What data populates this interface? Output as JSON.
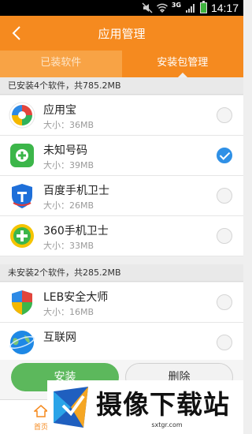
{
  "status_bar": {
    "time": "14:17",
    "network": "3G"
  },
  "header": {
    "title": "应用管理"
  },
  "tabs": [
    {
      "label": "已装软件",
      "active": false
    },
    {
      "label": "安装包管理",
      "active": true
    }
  ],
  "installed_section": {
    "heading": "已安装4个软件，共785.2MB",
    "items": [
      {
        "name": "应用宝",
        "size": "大小：36MB",
        "checked": false,
        "icon": "yingyongbao-icon"
      },
      {
        "name": "未知号码",
        "size": "大小：39MB",
        "checked": true,
        "icon": "unknown-number-icon"
      },
      {
        "name": "百度手机卫士",
        "size": "大小：26MB",
        "checked": false,
        "icon": "baidu-guard-icon"
      },
      {
        "name": "360手机卫士",
        "size": "大小：33MB",
        "checked": false,
        "icon": "360-guard-icon"
      }
    ]
  },
  "uninstalled_section": {
    "heading": "未安装2个软件，共285.2MB",
    "items": [
      {
        "name": "LEB安全大师",
        "size": "大小：16MB",
        "checked": false,
        "icon": "leb-shield-icon"
      },
      {
        "name": "互联网",
        "size": "",
        "checked": false,
        "icon": "globe-icon"
      }
    ]
  },
  "actions": {
    "install_label": "安装",
    "delete_label": "删除"
  },
  "bottom_nav": {
    "home_label": "首页"
  },
  "watermark": {
    "text": "摄像下载站",
    "url": "sxtgr.com"
  },
  "colors": {
    "accent": "#f58a1f",
    "install_green": "#5cb85c",
    "check_blue": "#2f90e6"
  }
}
